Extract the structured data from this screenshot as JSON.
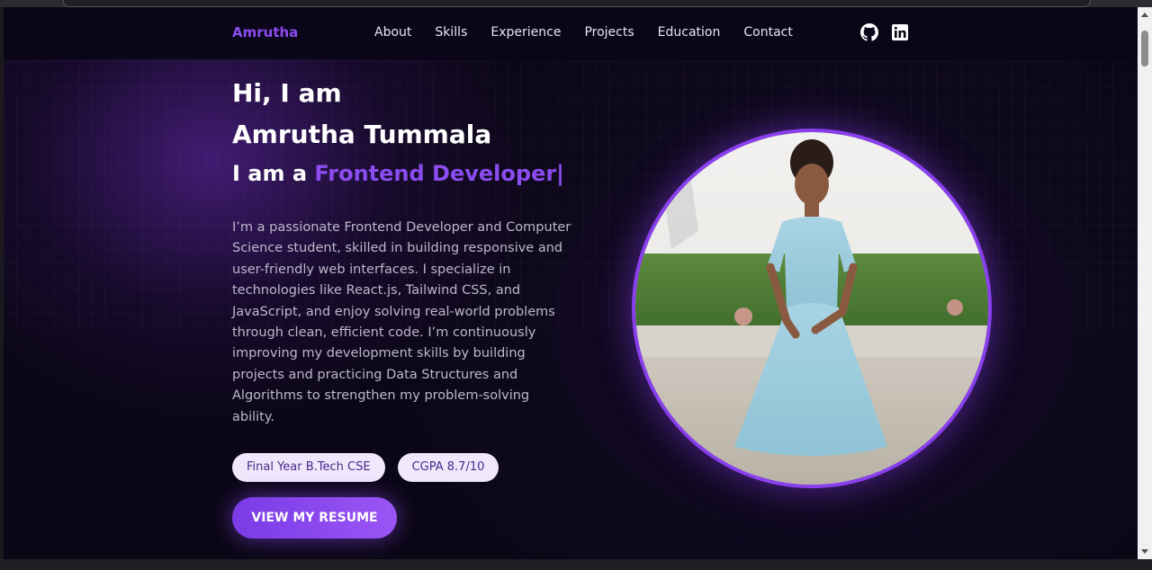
{
  "nav": {
    "brand": "Amrutha",
    "links": [
      "About",
      "Skills",
      "Experience",
      "Projects",
      "Education",
      "Contact"
    ],
    "social": [
      {
        "icon": "github-icon"
      },
      {
        "icon": "linkedin-icon"
      }
    ]
  },
  "hero": {
    "greeting": "Hi, I am",
    "name": "Amrutha Tummala",
    "role_prefix": "I am a ",
    "role_highlight": "Frontend Developer|",
    "bio": "I’m a passionate Frontend Developer and Computer Science student, skilled in building responsive and user-friendly web interfaces. I specialize in technologies like React.js, Tailwind CSS, and JavaScript, and enjoy solving real-world problems through clean, efficient code. I’m continuously improving my development skills by building projects and practicing Data Structures and Algorithms to strengthen my problem-solving ability.",
    "badges": [
      "Final Year B.Tech CSE",
      "CGPA 8.7/10"
    ],
    "cta": "VIEW MY RESUME",
    "photo_icon": "profile-photo"
  },
  "colors": {
    "accent": "#8b4cf0",
    "background": "#0b0716",
    "badge_bg": "#efe7fb"
  }
}
